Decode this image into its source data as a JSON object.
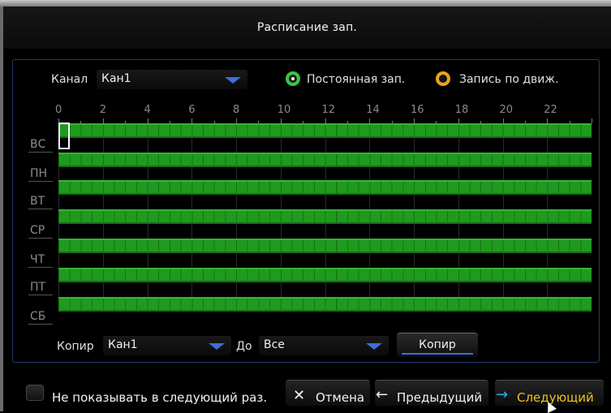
{
  "window": {
    "title": "Расписание зап."
  },
  "channel": {
    "label": "Канал",
    "value": "Кан1"
  },
  "modes": {
    "constant": {
      "label": "Постоянная зап.",
      "color": "#39c548",
      "selected": true
    },
    "motion": {
      "label": "Запись по движ.",
      "color": "#e6a61a",
      "selected": false
    }
  },
  "hours": [
    "0",
    "2",
    "4",
    "6",
    "8",
    "10",
    "12",
    "14",
    "16",
    "18",
    "20",
    "22"
  ],
  "days": [
    "ВС",
    "ПН",
    "ВТ",
    "СР",
    "ЧТ",
    "ПТ",
    "СБ"
  ],
  "schedule_color": "#1f9a1f",
  "copy": {
    "label": "Копир",
    "source": "Кан1",
    "to_label": "До",
    "target": "Все",
    "button": "Копир"
  },
  "footer": {
    "dont_show": "Не показывать в следующий раз.",
    "cancel": "Отмена",
    "prev": "Предыдущий",
    "next": "Следующий",
    "next_color": "#f2c21a",
    "arrow_color": "#2ab0e8"
  }
}
